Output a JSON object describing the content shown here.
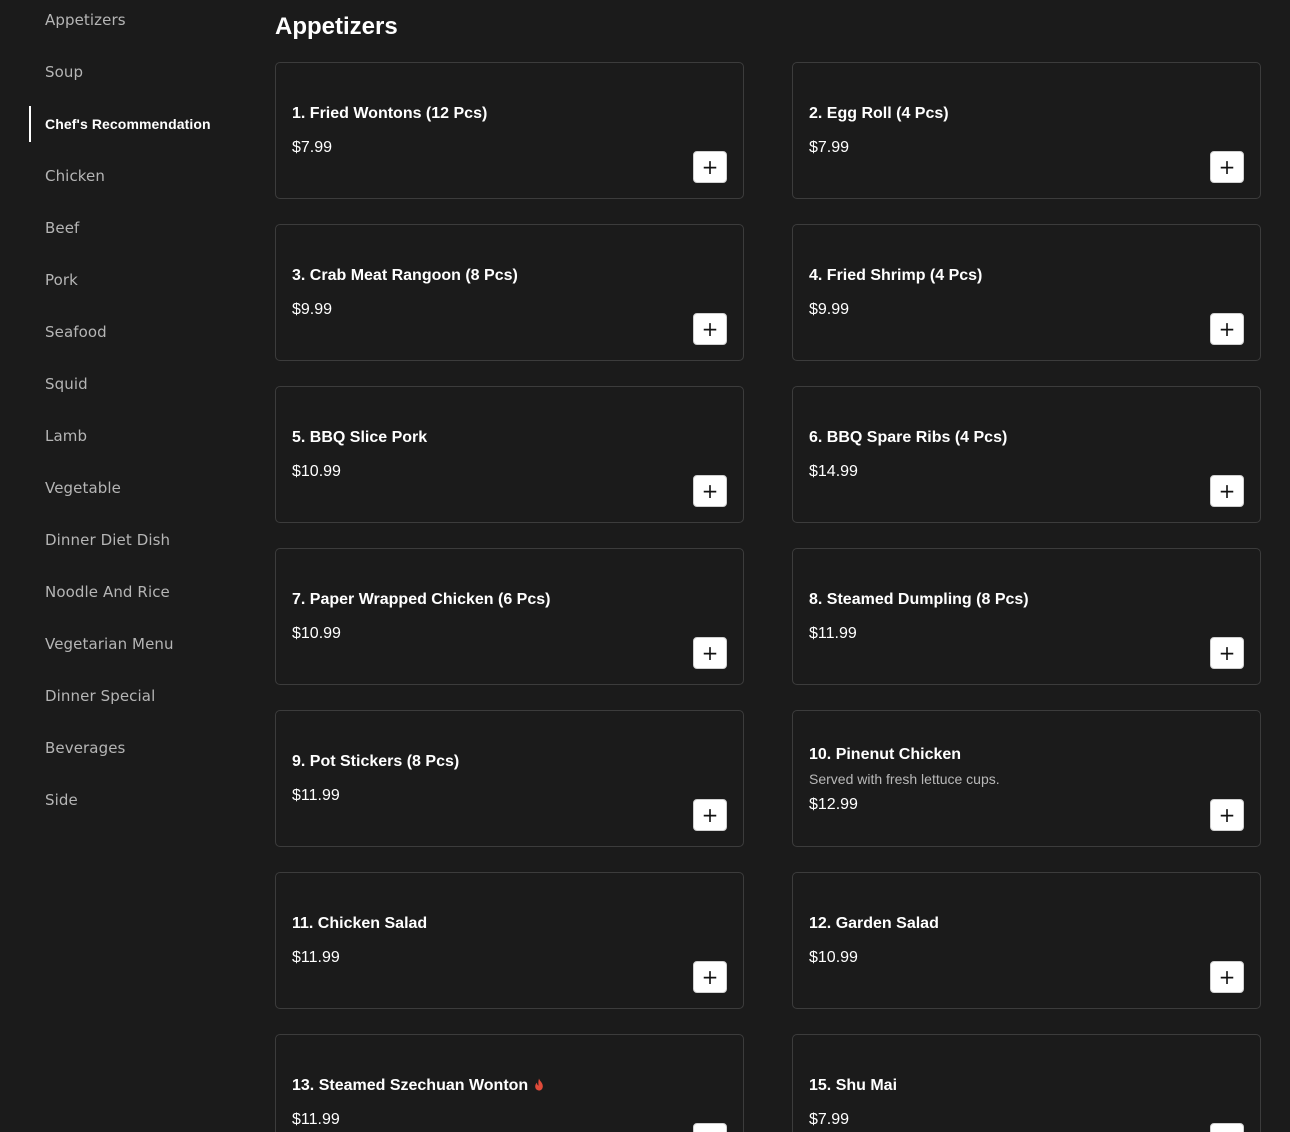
{
  "sidebar": {
    "items": [
      {
        "label": "Appetizers",
        "active": false
      },
      {
        "label": "Soup",
        "active": false
      },
      {
        "label": "Chef's Recommendation",
        "active": true
      },
      {
        "label": "Chicken",
        "active": false
      },
      {
        "label": "Beef",
        "active": false
      },
      {
        "label": "Pork",
        "active": false
      },
      {
        "label": "Seafood",
        "active": false
      },
      {
        "label": "Squid",
        "active": false
      },
      {
        "label": "Lamb",
        "active": false
      },
      {
        "label": "Vegetable",
        "active": false
      },
      {
        "label": "Dinner Diet Dish",
        "active": false
      },
      {
        "label": "Noodle And Rice",
        "active": false
      },
      {
        "label": "Vegetarian Menu",
        "active": false
      },
      {
        "label": "Dinner Special",
        "active": false
      },
      {
        "label": "Beverages",
        "active": false
      },
      {
        "label": "Side",
        "active": false
      }
    ]
  },
  "main": {
    "section_title": "Appetizers",
    "add_label": "+",
    "items": [
      {
        "name": "1. Fried Wontons (12 Pcs)",
        "price": "$7.99",
        "description": "",
        "spicy": false
      },
      {
        "name": "2. Egg Roll (4 Pcs)",
        "price": "$7.99",
        "description": "",
        "spicy": false
      },
      {
        "name": "3. Crab Meat Rangoon (8 Pcs)",
        "price": "$9.99",
        "description": "",
        "spicy": false
      },
      {
        "name": "4. Fried Shrimp (4 Pcs)",
        "price": "$9.99",
        "description": "",
        "spicy": false
      },
      {
        "name": "5. BBQ Slice Pork",
        "price": "$10.99",
        "description": "",
        "spicy": false
      },
      {
        "name": "6. BBQ Spare Ribs (4 Pcs)",
        "price": "$14.99",
        "description": "",
        "spicy": false
      },
      {
        "name": "7. Paper Wrapped Chicken (6 Pcs)",
        "price": "$10.99",
        "description": "",
        "spicy": false
      },
      {
        "name": "8. Steamed Dumpling (8 Pcs)",
        "price": "$11.99",
        "description": "",
        "spicy": false
      },
      {
        "name": "9. Pot Stickers (8 Pcs)",
        "price": "$11.99",
        "description": "",
        "spicy": false
      },
      {
        "name": "10. Pinenut Chicken",
        "price": "$12.99",
        "description": "Served with fresh lettuce cups.",
        "spicy": false
      },
      {
        "name": "11. Chicken Salad",
        "price": "$11.99",
        "description": "",
        "spicy": false
      },
      {
        "name": "12. Garden Salad",
        "price": "$10.99",
        "description": "",
        "spicy": false
      },
      {
        "name": "13. Steamed Szechuan Wonton",
        "price": "$11.99",
        "description": "",
        "spicy": true
      },
      {
        "name": "15. Shu Mai",
        "price": "$7.99",
        "description": "",
        "spicy": false
      }
    ]
  },
  "colors": {
    "background": "#1b1b1b",
    "card_border": "#3c3c3c",
    "sidebar_text": "#b5b5b5",
    "spicy": "#e04b3a"
  },
  "icons": {
    "spicy": "fire-icon",
    "add": "plus-icon"
  }
}
